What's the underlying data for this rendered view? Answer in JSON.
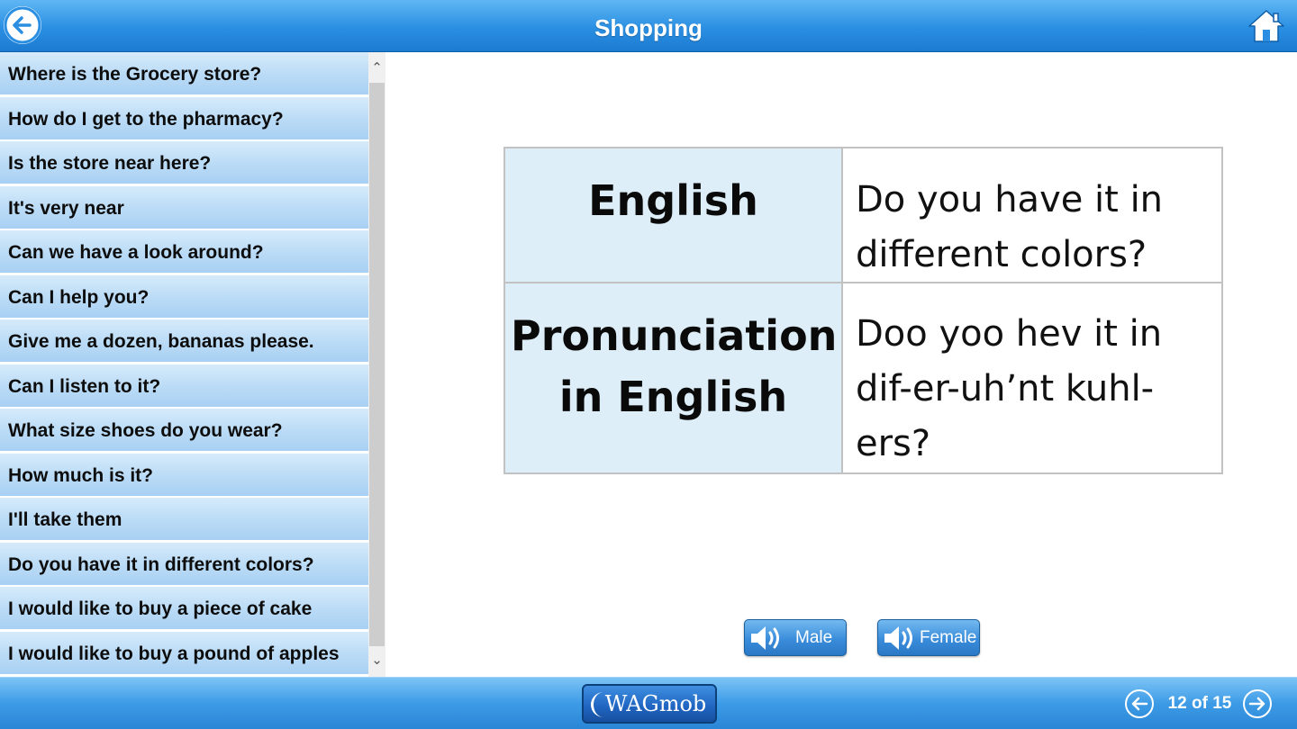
{
  "header": {
    "title": "Shopping",
    "back_icon": "arrow-left-circle-icon",
    "home_icon": "home-icon"
  },
  "sidebar": {
    "items": [
      {
        "label": "Where is the Grocery store?"
      },
      {
        "label": "How do I get to the pharmacy?"
      },
      {
        "label": "Is the store near here?"
      },
      {
        "label": "It's very near"
      },
      {
        "label": "Can we have a look around?"
      },
      {
        "label": "Can I help you?"
      },
      {
        "label": "Give me a dozen, bananas please."
      },
      {
        "label": "Can I listen to it?"
      },
      {
        "label": "What size shoes do you wear?"
      },
      {
        "label": "How much is it?"
      },
      {
        "label": "I'll take them"
      },
      {
        "label": "Do you have it in different colors?"
      },
      {
        "label": "I would like to buy a piece of cake"
      },
      {
        "label": "I would like to buy a pound of apples"
      }
    ],
    "selected_index": 11
  },
  "phrase": {
    "english_label": "English",
    "english_value": "Do you have it in different colors?",
    "pronunciation_label": "Pronunciation in English",
    "pronunciation_value": "Doo yoo hev it in dif-er-uh’nt kuhl-ers?"
  },
  "audio": {
    "male_label": "Male",
    "female_label": "Female",
    "icon": "speaker-icon"
  },
  "footer": {
    "brand": "WAGmob",
    "page_counter": "12 of 15",
    "prev_icon": "arrow-left-circle-icon",
    "next_icon": "arrow-right-circle-icon"
  },
  "colors": {
    "header_blue": "#2a8fe2",
    "list_item_blue": "#bcdcf6",
    "label_cell_bg": "#ddeef8"
  }
}
